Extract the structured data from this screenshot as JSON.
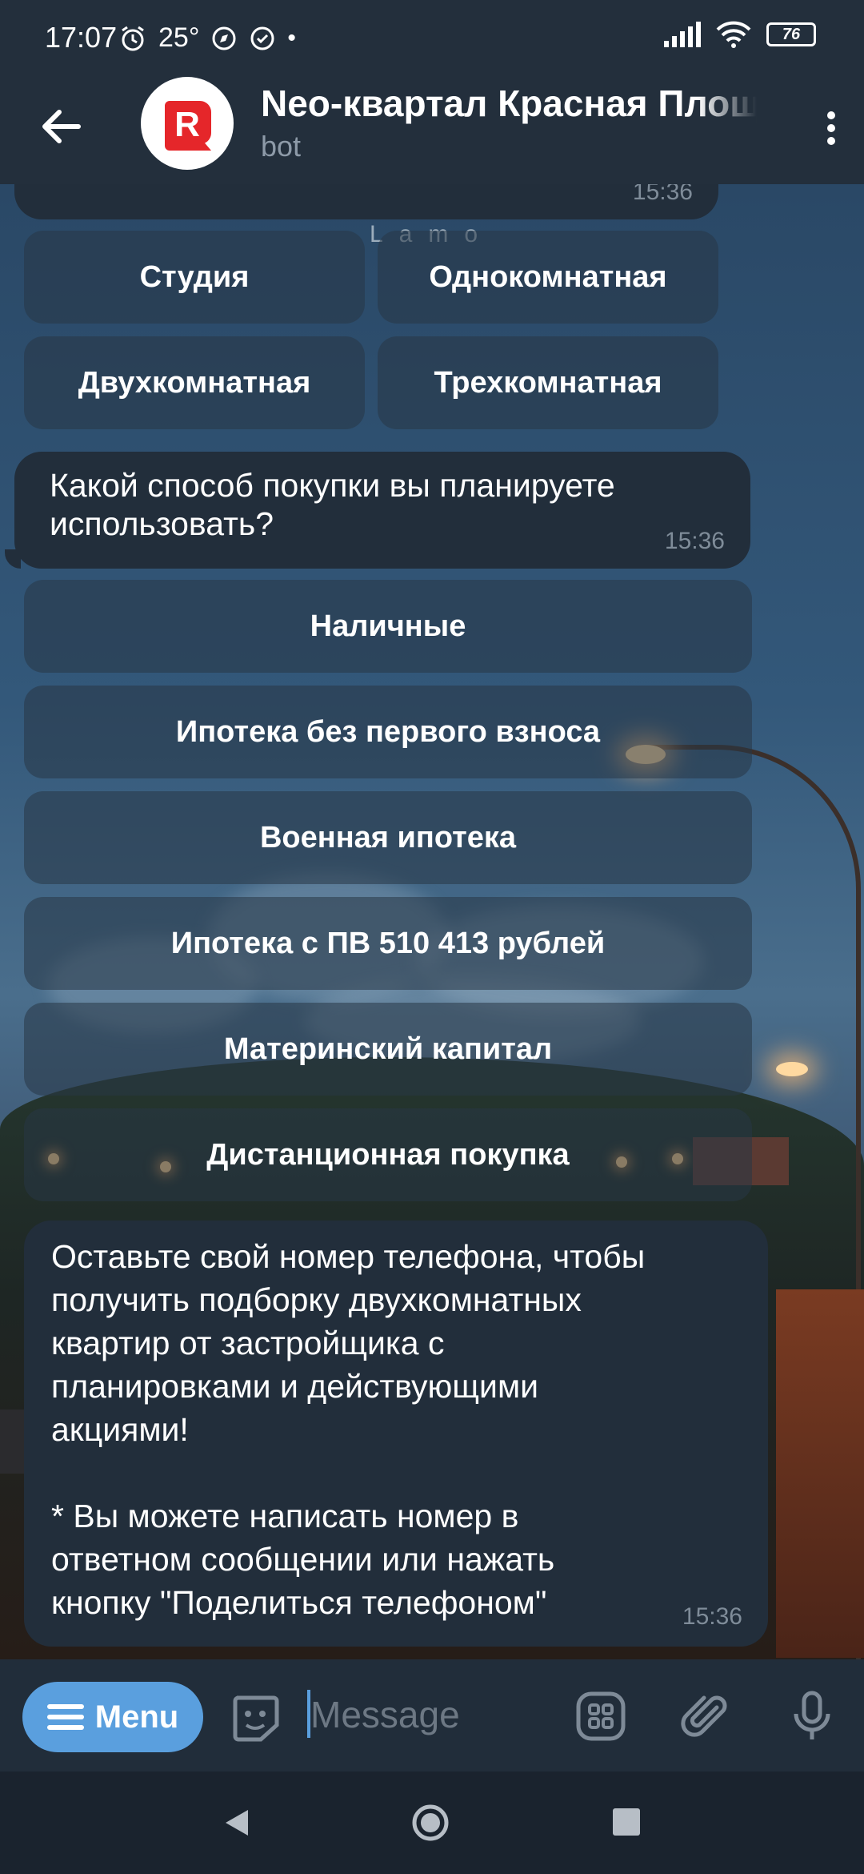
{
  "status_bar": {
    "time": "17:07",
    "temp": "25°",
    "battery": "76"
  },
  "header": {
    "title": "Neo-квартал Красная Площадь",
    "subtitle": "bot",
    "avatar_letter": "R"
  },
  "chat": {
    "prev_time": "15:36",
    "watermark": "Lamo",
    "room_buttons": [
      "Студия",
      "Однокомнатная",
      "Двухкомнатная",
      "Трехкомнатная"
    ],
    "purchase_question": "Какой способ покупки вы планируете использовать?",
    "purchase_time": "15:36",
    "purchase_buttons": [
      "Наличные",
      "Ипотека без первого взноса",
      "Военная ипотека",
      "Ипотека с ПВ 510 413 рублей",
      "Материнский капитал",
      "Дистанционная покупка"
    ],
    "phone_message_lines": [
      "Оставьте свой номер телефона, чтобы",
      "получить подборку двухкомнатных",
      "квартир от застройщика с",
      "планировками и действующими",
      "акциями!",
      "",
      "* Вы можете написать номер в",
      "ответном сообщении или нажать",
      "кнопку \"Поделиться телефоном\""
    ],
    "phone_time": "15:36"
  },
  "input_bar": {
    "menu_label": "Menu",
    "placeholder": "Message"
  },
  "colors": {
    "accent": "#5a9fde",
    "bubble": "#222e3b",
    "header": "#232f3c",
    "avatar_red": "#e5262a"
  }
}
